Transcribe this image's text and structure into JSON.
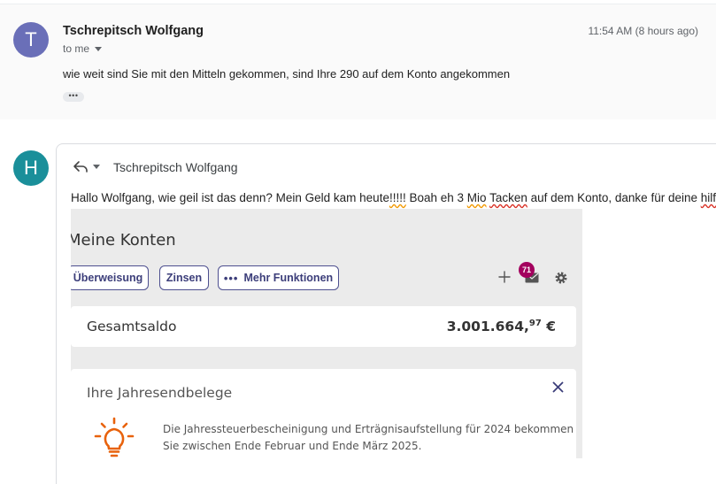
{
  "message1": {
    "avatar_letter": "T",
    "sender": "Tschrepitsch Wolfgang",
    "recipient_label": "to me",
    "timestamp": "11:54 AM (8 hours ago)",
    "body": "wie weit sind Sie mit den Mitteln gekommen, sind Ihre 290 auf dem Konto angekommen",
    "show_trimmed_label": "•••"
  },
  "reply": {
    "avatar_letter": "H",
    "to_name": "Tschrepitsch Wolfgang",
    "text_parts": {
      "p1": "Hallo Wolfgang, wie geil ist das denn? Mein Geld kam heute",
      "p2": "!!!!!",
      "p3": " Boah eh 3 ",
      "p4": "Mio",
      "p5": " ",
      "p6": "Tacken",
      "p7": " auf dem Konto, danke für deine ",
      "p8": "hilfe",
      "p9": "!"
    }
  },
  "embedded_screenshot": {
    "title": "Meine Konten",
    "buttons": {
      "transfer": "Überweisung",
      "interest": "Zinsen",
      "more": "Mehr Funktionen",
      "more_dots": "•••"
    },
    "mail_badge_count": "71",
    "balance_label": "Gesamtsaldo",
    "balance_main": "3.001.664,",
    "balance_cents": "97",
    "balance_currency": " €",
    "notice_title": "Ihre Jahresendbelege",
    "notice_line1": "Die Jahressteuerbescheinigung und Erträgnisaufstellung für 2024 bekommen",
    "notice_line2": "Sie zwischen Ende Februar und Ende März 2025."
  },
  "colors": {
    "avatar_t": "#6a6fb8",
    "avatar_h": "#1a8f9a",
    "bank_accent": "#3c3e7a",
    "badge": "#a3005e",
    "bulb": "#e8620c"
  }
}
